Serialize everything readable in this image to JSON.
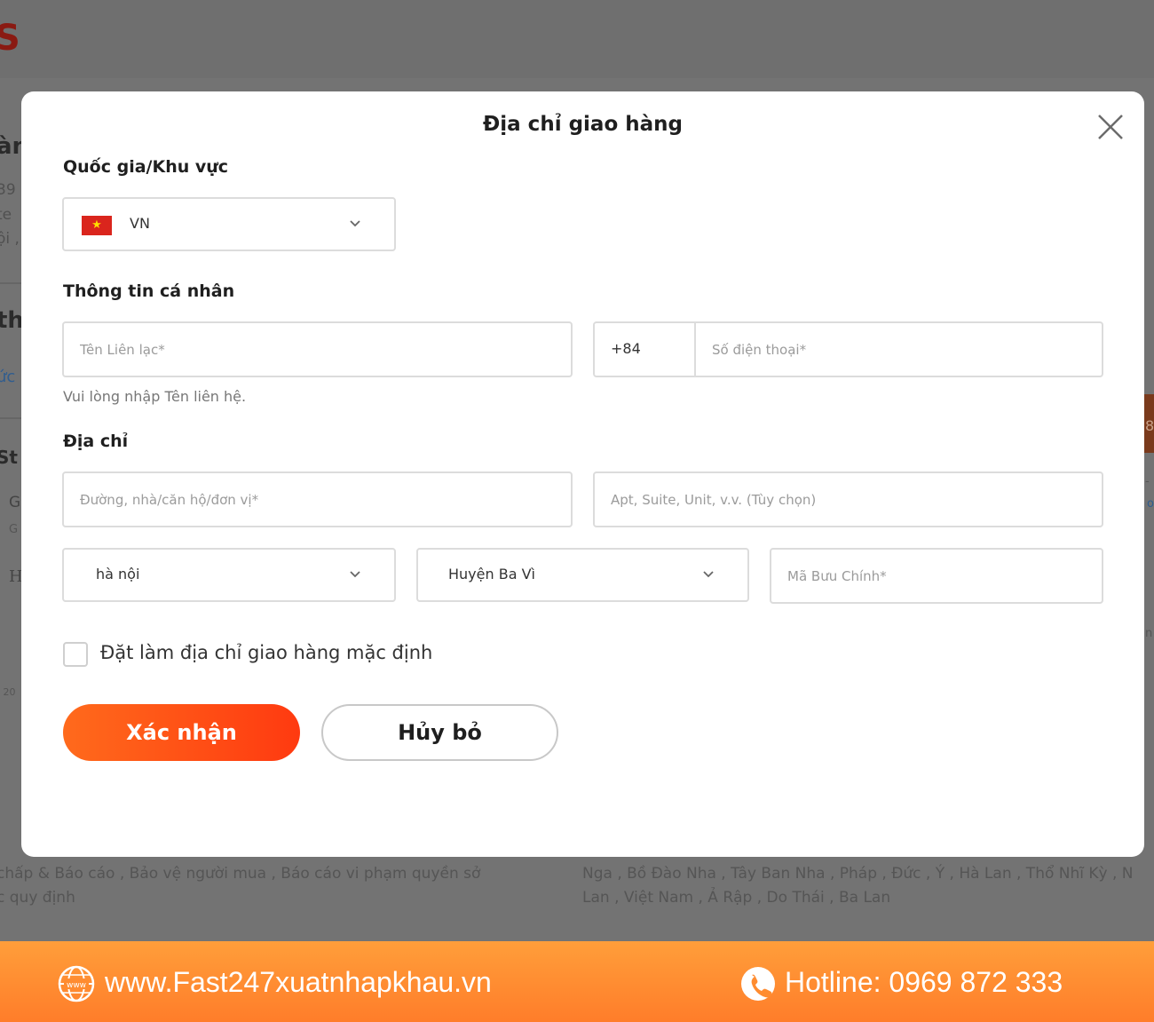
{
  "background": {
    "logo_fragment": "S",
    "heading_fragment": "àn",
    "line1": "39",
    "line2": "te",
    "line3": "ội ,",
    "heading2_fragment": "th",
    "link_fragment": "ức",
    "heading3_fragment": "St",
    "item1": "G",
    "item2": "G",
    "item3": "H",
    "item4": "- 20",
    "side_tab": "8",
    "side1": "-",
    "side2": "o",
    "side3": "n",
    "footer_left_line1": "chấp & Báo cáo , Bảo vệ người mua , Báo cáo vi phạm quyền sở",
    "footer_left_line2": "c quy định",
    "footer_right_line1": "Nga , Bồ Đào Nha , Tây Ban Nha , Pháp , Đức , Ý , Hà Lan , Thổ Nhĩ Kỳ , N",
    "footer_right_line2": "Lan , Việt Nam , Ả Rập , Do Thái , Ba Lan"
  },
  "modal": {
    "title": "Địa chỉ giao hàng",
    "country_section": {
      "label": "Quốc gia/Khu vực",
      "selected": "VN"
    },
    "personal_section": {
      "label": "Thông tin cá nhân",
      "contact_placeholder": "Tên Liên lạc*",
      "phone_code": "+84",
      "phone_placeholder": "Số điện thoại*",
      "hint": "Vui lòng nhập Tên liên hệ."
    },
    "address_section": {
      "label": "Địa chỉ",
      "street_placeholder": "Đường, nhà/căn hộ/đơn vị*",
      "apt_placeholder": "Apt, Suite, Unit, v.v. (Tùy chọn)",
      "province": "hà nội",
      "district": "Huyện Ba Vì",
      "postal_placeholder": "Mã Bưu Chính*"
    },
    "default_checkbox_label": "Đặt làm địa chỉ giao hàng mặc định",
    "confirm_label": "Xác nhận",
    "cancel_label": "Hủy bỏ"
  },
  "promo": {
    "website": "www.Fast247xuatnhapkhau.vn",
    "hotline": "Hotline: 0969 872 333",
    "globe_badge": "www"
  },
  "colors": {
    "accent_start": "#ff6a1c",
    "accent_end": "#ff3a10",
    "promo_bar": "#ff8c30"
  },
  "icons": {
    "close": "close-icon",
    "chevron": "chevron-down-icon",
    "flag": "vietnam-flag-icon",
    "globe": "globe-icon",
    "phone": "phone-icon"
  }
}
